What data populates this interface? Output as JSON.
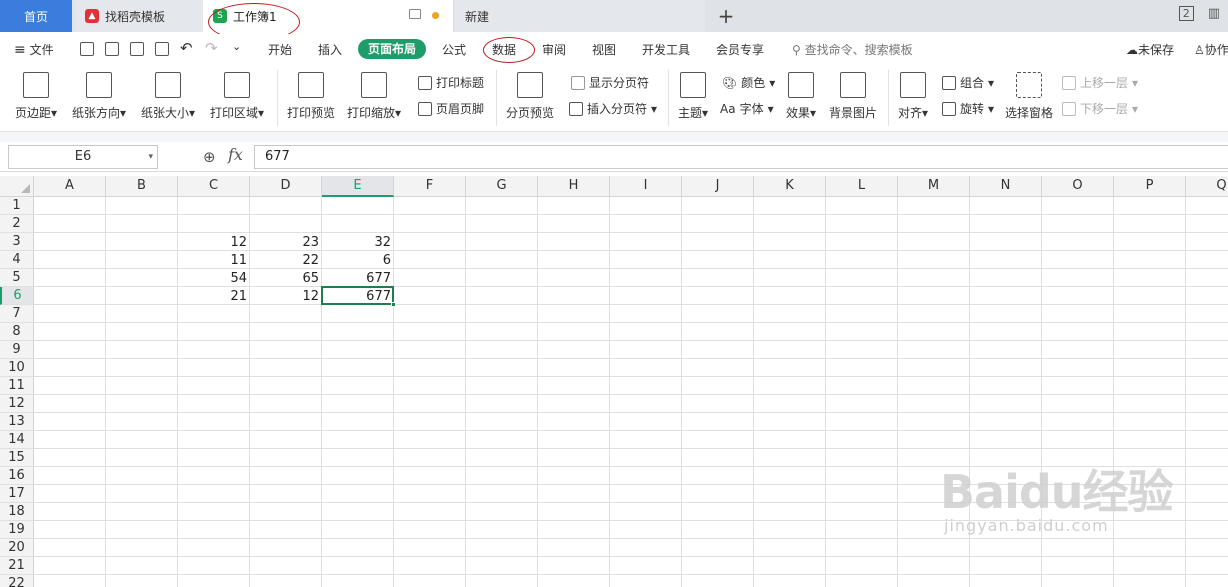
{
  "tabs": {
    "home": "首页",
    "docer": "找稻壳模板",
    "workbook": "工作簿1",
    "new": "新建",
    "add": "+"
  },
  "window": {
    "page_count": "2"
  },
  "menu": {
    "file": "文件",
    "items": [
      "开始",
      "插入",
      "页面布局",
      "公式",
      "数据",
      "审阅",
      "视图",
      "开发工具",
      "会员专享"
    ],
    "search": "查找命令、搜索模板",
    "unsaved": "未保存",
    "collab": "协作"
  },
  "ribbon": {
    "margins": "页边距",
    "orientation": "纸张方向",
    "size": "纸张大小",
    "print_area": "打印区域",
    "print_preview": "打印预览",
    "print_scale": "打印缩放",
    "print_titles": "打印标题",
    "header_footer": "页眉页脚",
    "page_break_preview": "分页预览",
    "show_page_breaks": "显示分页符",
    "insert_page_break": "插入分页符",
    "theme": "主题",
    "colors": "颜色",
    "fonts": "字体",
    "effects": "效果",
    "background": "背景图片",
    "align": "对齐",
    "group": "组合",
    "rotate": "旋转",
    "selection_pane": "选择窗格",
    "bring_forward": "上移一层",
    "send_backward": "下移一层"
  },
  "formula_bar": {
    "name_box": "E6",
    "fx": "fx",
    "value": "677"
  },
  "sheet": {
    "columns": [
      "A",
      "B",
      "C",
      "D",
      "E",
      "F",
      "G",
      "H",
      "I",
      "J",
      "K",
      "L",
      "M",
      "N",
      "O",
      "P",
      "Q"
    ],
    "rows": [
      "1",
      "2",
      "3",
      "4",
      "5",
      "6",
      "7",
      "8",
      "9",
      "10",
      "11",
      "12",
      "13",
      "14",
      "15",
      "16",
      "17",
      "18",
      "19",
      "20",
      "21",
      "22"
    ],
    "selected_column": "E",
    "selected_row": "6",
    "data": [
      {
        "row": 3,
        "C": "12",
        "D": "23",
        "E": "32"
      },
      {
        "row": 4,
        "C": "11",
        "D": "22",
        "E": "6"
      },
      {
        "row": 5,
        "C": "54",
        "D": "65",
        "E": "677"
      },
      {
        "row": 6,
        "C": "21",
        "D": "12",
        "E": "677"
      }
    ]
  },
  "watermark": {
    "line1": "Baidu经验",
    "line2": "jingyan.baidu.com"
  },
  "colors": {
    "accent": "#1e9c69",
    "home_tab": "#3b7ddd",
    "annotation": "#c21a1a"
  }
}
